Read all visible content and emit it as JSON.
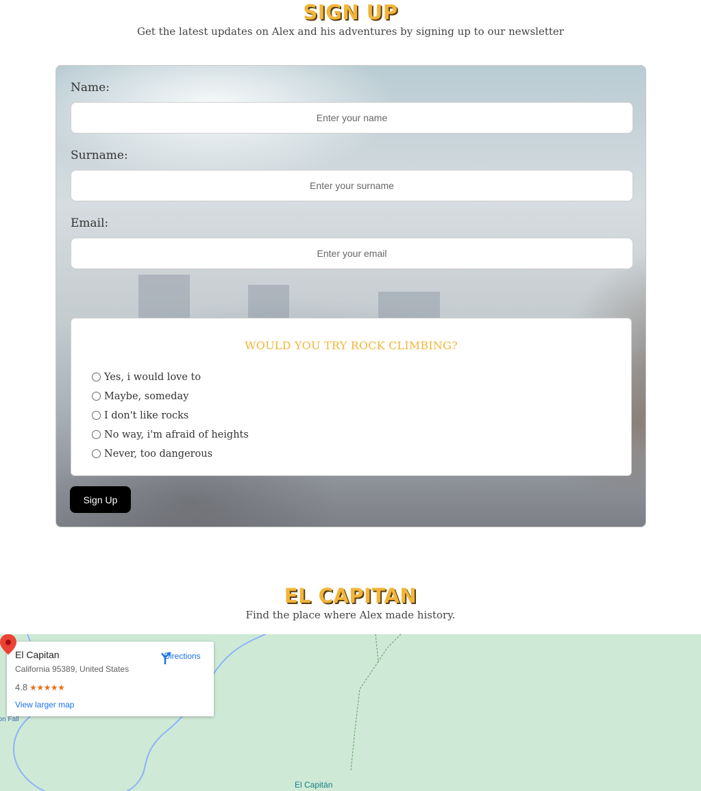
{
  "signup": {
    "title": "SIGN UP",
    "subtitle": "Get the latest updates on Alex and his adventures by signing up to our newsletter",
    "fields": [
      {
        "label": "Name:",
        "placeholder": "Enter your name",
        "value": ""
      },
      {
        "label": "Surname:",
        "placeholder": "Enter your surname",
        "value": ""
      },
      {
        "label": "Email:",
        "placeholder": "Enter your email",
        "value": ""
      }
    ],
    "question": "WOULD YOU TRY ROCK CLIMBING?",
    "options": [
      "Yes, i would love to",
      "Maybe, someday",
      "I don't like rocks",
      "No way, i'm afraid of heights",
      "Never, too dangerous"
    ],
    "button_label": "Sign Up"
  },
  "location": {
    "title": "EL CAPITAN",
    "subtitle": "Find the place where Alex made history."
  },
  "map": {
    "place_name": "El Capitan",
    "address": "California 95389, United States",
    "rating": "4.8",
    "stars": "★★★★★",
    "directions_label": "Directions",
    "larger_map_label": "View larger map",
    "fall_label": "bon Fall",
    "marker_label": "El Capitán",
    "colors": {
      "land": "#cfe9d7",
      "water": "#8ab4f8",
      "link": "#1a73e8",
      "star": "#e7711b",
      "pin": "#ea4335"
    },
    "icons": [
      "directions-icon",
      "map-pin-icon"
    ]
  },
  "theme": {
    "accent": "#f2b53a",
    "button": "#000000"
  }
}
